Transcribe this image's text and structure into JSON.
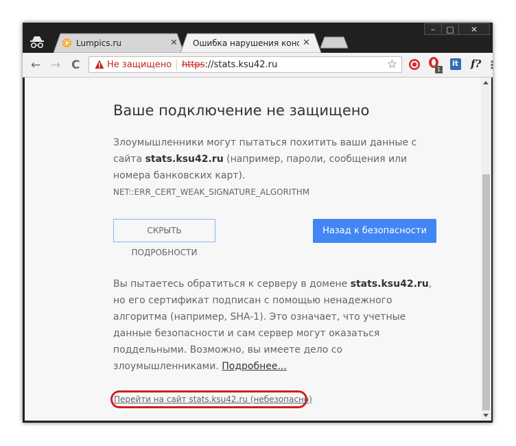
{
  "tabs": [
    {
      "title": "Lumpics.ru",
      "active": false
    },
    {
      "title": "Ошибка нарушения конфид",
      "active": true
    }
  ],
  "window_controls": {
    "minimize": "–",
    "maximize": "□",
    "close": "✕"
  },
  "toolbar": {
    "back": "←",
    "forward": "→",
    "reload": "C",
    "star": "☆",
    "menu": "⋮"
  },
  "omnibox": {
    "security_label": "Не защищено",
    "scheme": "https",
    "rest": "://stats.ksu42.ru"
  },
  "extensions": {
    "badge_count": "1",
    "f_label": "f?",
    "it_label": "it"
  },
  "page": {
    "heading": "Ваше подключение не защищено",
    "intro_pre": "Злоумышленники могут пытаться похитить ваши данные с сайта",
    "intro_domain": "stats.ksu42.ru",
    "intro_post": "(например, пароли, сообщения или номера банковских карт).",
    "error_code": "NET::ERR_CERT_WEAK_SIGNATURE_ALGORITHM",
    "details_button": "СКРЫТЬ ПОДРОБНОСТИ",
    "back_button": "Назад к безопасности",
    "detail_pre": "Вы пытаетесь обратиться к серверу в домене",
    "detail_domain": "stats.ksu42.ru",
    "detail_post": ", но его сертификат подписан с помощью ненадежного алгоритма (например, SHA-1). Это означает, что учетные данные безопасности и сам сервер могут оказаться поддельными. Возможно, вы имеете дело со злоумышленниками.",
    "learn_more": "Подробнее...",
    "proceed_link": "Перейти на сайт stats.ksu42.ru (небезопасно)"
  },
  "colors": {
    "accent": "#4285f4",
    "danger": "#c5221f",
    "highlight": "#d21e1e"
  }
}
